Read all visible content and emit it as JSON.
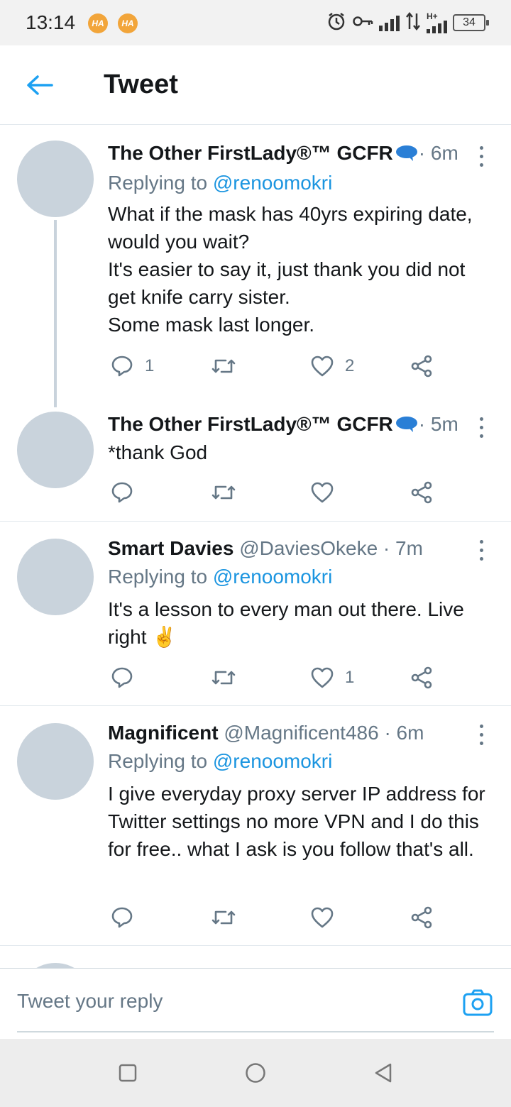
{
  "status_bar": {
    "time": "13:14",
    "notif_badge_1": "HA",
    "notif_badge_2": "HA",
    "network_label": "H+",
    "battery": "34"
  },
  "header": {
    "title": "Tweet"
  },
  "tweets": [
    {
      "name": "The Other FirstLady®™ GCFR",
      "handle": "",
      "time": "· 6m",
      "replying_label": "Replying to ",
      "replying_to": "@renoomokri",
      "body": "What if the mask has 40yrs expiring date, would you wait?\nIt's easier to say it, just thank you did not get knife carry sister.\nSome mask last longer.",
      "reply_count": "1",
      "retweet_count": "",
      "like_count": "2"
    },
    {
      "name": "The Other FirstLady®™ GCFR",
      "handle": "",
      "time": "· 5m",
      "body": "*thank God",
      "reply_count": "",
      "retweet_count": "",
      "like_count": ""
    },
    {
      "name": "Smart Davies",
      "handle": " @DaviesOkeke",
      "time": " · 7m",
      "replying_label": "Replying to ",
      "replying_to": "@renoomokri",
      "body": "It's a lesson to every man out there. Live right ✌️",
      "reply_count": "",
      "retweet_count": "",
      "like_count": "1"
    },
    {
      "name": "Magnificent",
      "handle": " @Magnificent486",
      "time": " · 6m",
      "replying_label": "Replying to ",
      "replying_to": "@renoomokri",
      "body": "I give everyday proxy server IP address for Twitter settings no more VPN and I do this for free.. what I ask is you follow that's all.",
      "reply_count": "",
      "retweet_count": "",
      "like_count": ""
    }
  ],
  "reply_bar": {
    "placeholder": "Tweet your reply"
  },
  "colors": {
    "accent": "#1da1f2",
    "avatar": "#c9d3dc",
    "secondary_text": "#657786"
  }
}
